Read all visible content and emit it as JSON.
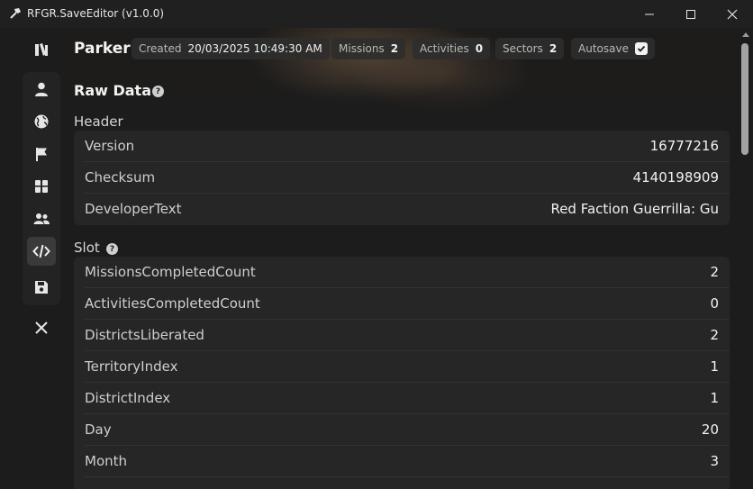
{
  "window": {
    "title": "RFGR.SaveEditor (v1.0.0)"
  },
  "sidebar": {
    "items": [
      {
        "name": "home",
        "icon": "book-icon",
        "active": false
      },
      {
        "name": "profile",
        "icon": "person-icon",
        "active": false
      },
      {
        "name": "world",
        "icon": "globe-icon",
        "active": false
      },
      {
        "name": "missions",
        "icon": "flag-icon",
        "active": false
      },
      {
        "name": "upgrades",
        "icon": "columns-icon",
        "active": false
      },
      {
        "name": "people",
        "icon": "people-icon",
        "active": false
      },
      {
        "name": "raw-data",
        "icon": "code-icon",
        "active": true
      },
      {
        "name": "save",
        "icon": "floppy-disk-icon",
        "active": false
      },
      {
        "name": "close",
        "icon": "close-icon",
        "active": false
      }
    ]
  },
  "header": {
    "profile_name": "Parker",
    "created": {
      "label": "Created",
      "value": "20/03/2025 10:49:30 AM"
    },
    "missions": {
      "label": "Missions",
      "value": "2"
    },
    "activities": {
      "label": "Activities",
      "value": "0"
    },
    "sectors": {
      "label": "Sectors",
      "value": "2"
    },
    "autosave": {
      "label": "Autosave",
      "checked": true
    }
  },
  "page": {
    "title": "Raw Data"
  },
  "sections": {
    "header": {
      "title": "Header",
      "rows": [
        {
          "key": "Version",
          "value": "16777216"
        },
        {
          "key": "Checksum",
          "value": "4140198909"
        },
        {
          "key": "DeveloperText",
          "value": "Red Faction Guerrilla: Gu"
        }
      ]
    },
    "slot": {
      "title": "Slot",
      "rows": [
        {
          "key": "MissionsCompletedCount",
          "value": "2"
        },
        {
          "key": "ActivitiesCompletedCount",
          "value": "0"
        },
        {
          "key": "DistrictsLiberated",
          "value": "2"
        },
        {
          "key": "TerritoryIndex",
          "value": "1"
        },
        {
          "key": "DistrictIndex",
          "value": "1"
        },
        {
          "key": "Day",
          "value": "20"
        },
        {
          "key": "Month",
          "value": "3"
        }
      ]
    }
  },
  "colors": {
    "background": "#1c1c1c",
    "card": "#262626",
    "active_nav": "#3a3a3a",
    "text": "#f2f2f2"
  }
}
